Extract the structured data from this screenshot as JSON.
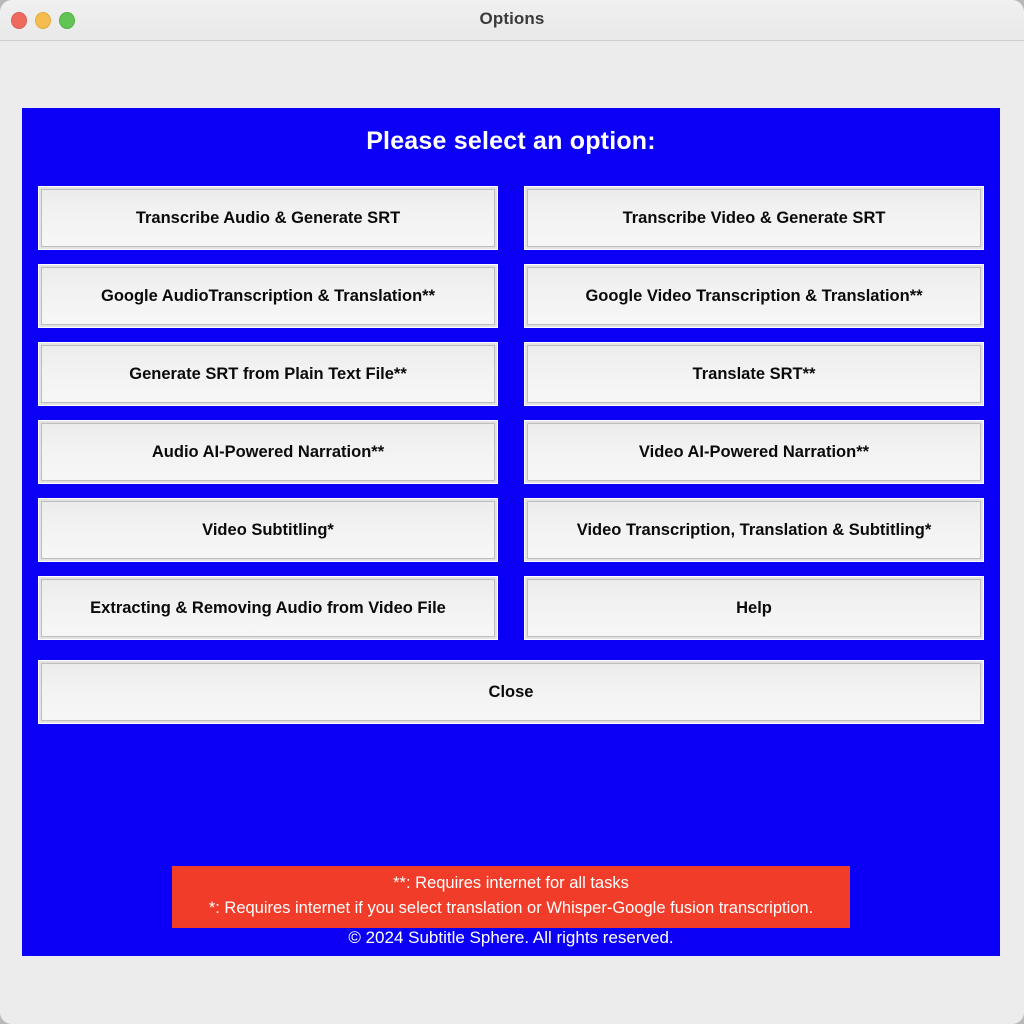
{
  "window": {
    "title": "Options",
    "traffic_lights": [
      {
        "name": "close",
        "color": "#ee6a5f"
      },
      {
        "name": "minimize",
        "color": "#f5bd4f"
      },
      {
        "name": "maximize",
        "color": "#61c454"
      }
    ]
  },
  "panel": {
    "background_color": "#0b00f5",
    "heading": "Please select an option:",
    "rows": [
      {
        "left": "Transcribe Audio & Generate SRT",
        "right": "Transcribe Video & Generate SRT"
      },
      {
        "left": "Google AudioTranscription & Translation**",
        "right": "Google Video Transcription & Translation**"
      },
      {
        "left": "Generate SRT from Plain Text File**",
        "right": "Translate SRT**"
      },
      {
        "left": "Audio AI-Powered Narration**",
        "right": "Video AI-Powered Narration**"
      },
      {
        "left": "Video Subtitling*",
        "right": "Video Transcription, Translation & Subtitling*"
      },
      {
        "left": "Extracting & Removing Audio from Video File",
        "right": "Help"
      }
    ],
    "close_label": "Close",
    "warning": {
      "background_color": "#f03c28",
      "line1": "**: Requires internet for all tasks",
      "line2": "*: Requires internet if you select translation or Whisper-Google fusion transcription."
    },
    "footer": "© 2024 Subtitle Sphere. All rights reserved."
  }
}
